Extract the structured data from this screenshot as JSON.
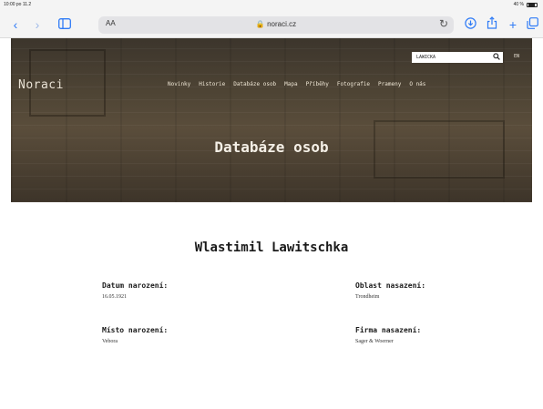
{
  "status_bar": {
    "time": "10:00  po 11.2",
    "battery": "40 %"
  },
  "browser": {
    "text_size_label": "AA",
    "url": "noraci.cz",
    "icons": {
      "back": "chevron-left-icon",
      "forward": "chevron-right-icon",
      "sidebar": "sidebar-icon",
      "reload": "reload-icon",
      "downloads": "download-icon",
      "share": "share-icon",
      "new_tab": "plus-icon",
      "tabs": "tabs-icon"
    },
    "accent_color": "#2f7bf6"
  },
  "site": {
    "logo": "Noraci",
    "nav": [
      "Novinky",
      "Historie",
      "Databáze osob",
      "Mapa",
      "Příběhy",
      "Fotografie",
      "Prameny",
      "O nás"
    ],
    "search": {
      "value": "LAWICKA",
      "icon": "search-icon"
    },
    "language": "EN",
    "hero_title": "Databáze osob"
  },
  "person": {
    "name": "Wlastimil Lawitschka",
    "fields": {
      "birth_date": {
        "label": "Datum narození:",
        "value": "16.05.1921"
      },
      "birth_place": {
        "label": "Místo narození:",
        "value": "Vebora"
      },
      "deployment_area": {
        "label": "Oblast nasazení:",
        "value": "Trondheim"
      },
      "deployment_company": {
        "label": "Firma nasazení:",
        "value": "Sager & Woerner"
      }
    }
  }
}
